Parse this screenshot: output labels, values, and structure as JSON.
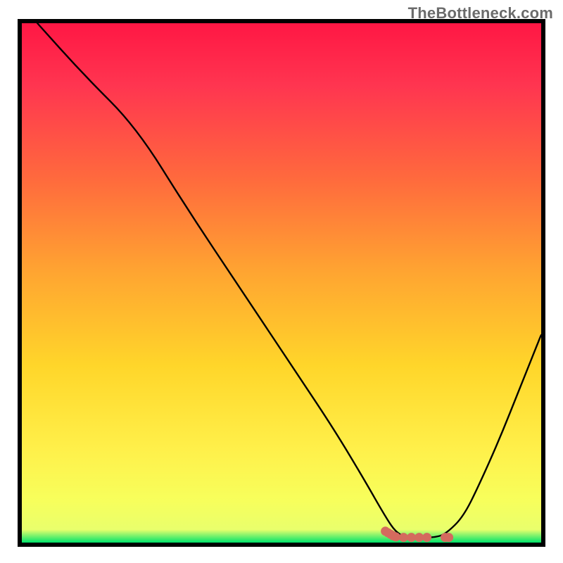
{
  "watermark": "TheBottleneck.com",
  "chart_data": {
    "type": "line",
    "title": "",
    "subtitle": "",
    "xlabel": "",
    "ylabel": "",
    "xlim": [
      0,
      100
    ],
    "ylim": [
      0,
      100
    ],
    "grid": false,
    "legend": false,
    "background_gradient_stops": [
      {
        "offset": 0.0,
        "color": "#ff1744"
      },
      {
        "offset": 0.12,
        "color": "#ff3550"
      },
      {
        "offset": 0.3,
        "color": "#ff6a3d"
      },
      {
        "offset": 0.48,
        "color": "#ffa531"
      },
      {
        "offset": 0.66,
        "color": "#ffd62a"
      },
      {
        "offset": 0.82,
        "color": "#fff04a"
      },
      {
        "offset": 0.92,
        "color": "#f7ff5c"
      },
      {
        "offset": 0.975,
        "color": "#e9ff6c"
      },
      {
        "offset": 1.0,
        "color": "#00e36b"
      }
    ],
    "series": [
      {
        "name": "bottleneck-curve",
        "color": "#000000",
        "x": [
          3,
          12,
          22,
          32,
          42,
          52,
          60,
          66,
          70,
          72,
          74,
          76,
          80,
          82,
          85,
          88,
          92,
          96,
          100
        ],
        "y": [
          100,
          90,
          80,
          64,
          49,
          34,
          22,
          12,
          5,
          2,
          1,
          1,
          1,
          2,
          5,
          11,
          20,
          30,
          40
        ]
      }
    ],
    "markers": {
      "name": "optimal-range-markers",
      "color": "#d46a5e",
      "points": [
        {
          "x": 70.0,
          "y": 2.2
        },
        {
          "x": 70.5,
          "y": 1.9
        },
        {
          "x": 71.0,
          "y": 1.6
        },
        {
          "x": 71.5,
          "y": 1.3
        },
        {
          "x": 72.0,
          "y": 1.1
        },
        {
          "x": 73.5,
          "y": 1.0
        },
        {
          "x": 75.0,
          "y": 1.0
        },
        {
          "x": 76.5,
          "y": 1.0
        },
        {
          "x": 78.0,
          "y": 1.0
        },
        {
          "x": 81.5,
          "y": 1.0
        },
        {
          "x": 82.2,
          "y": 1.0
        }
      ]
    }
  }
}
